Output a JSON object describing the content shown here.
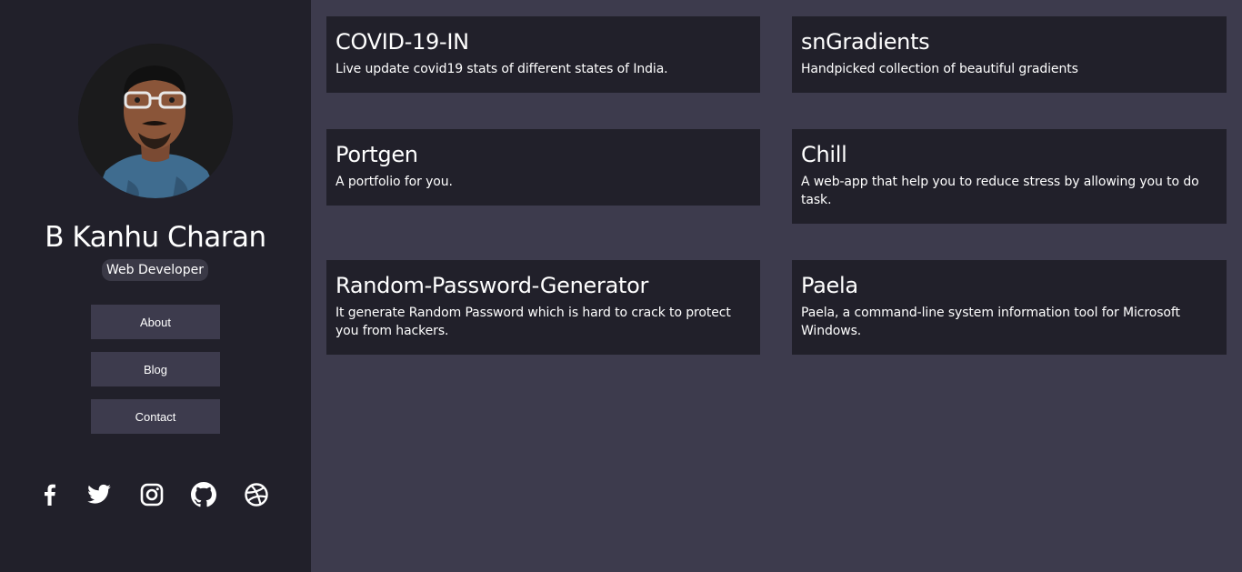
{
  "profile": {
    "name": "B Kanhu Charan",
    "role": "Web Developer"
  },
  "nav": {
    "about": "About",
    "blog": "Blog",
    "contact": "Contact"
  },
  "social": [
    "facebook-icon",
    "twitter-icon",
    "instagram-icon",
    "github-icon",
    "dribbble-icon"
  ],
  "projects": [
    {
      "title": "COVID-19-IN",
      "description": "Live update covid19 stats of different states of India."
    },
    {
      "title": "snGradients",
      "description": "Handpicked collection of beautiful gradients"
    },
    {
      "title": "Portgen",
      "description": "A portfolio for you."
    },
    {
      "title": "Chill",
      "description": "A web-app that help you to reduce stress by allowing you to do task."
    },
    {
      "title": "Random-Password-Generator",
      "description": "It generate Random Password which is hard to crack to protect you from hackers."
    },
    {
      "title": "Paela",
      "description": "Paela, a command-line system information tool for Microsoft Windows."
    }
  ],
  "colors": {
    "sidebar": "#21202a",
    "main": "#3d3b4d",
    "card": "#21202a",
    "text": "#ffffff"
  }
}
